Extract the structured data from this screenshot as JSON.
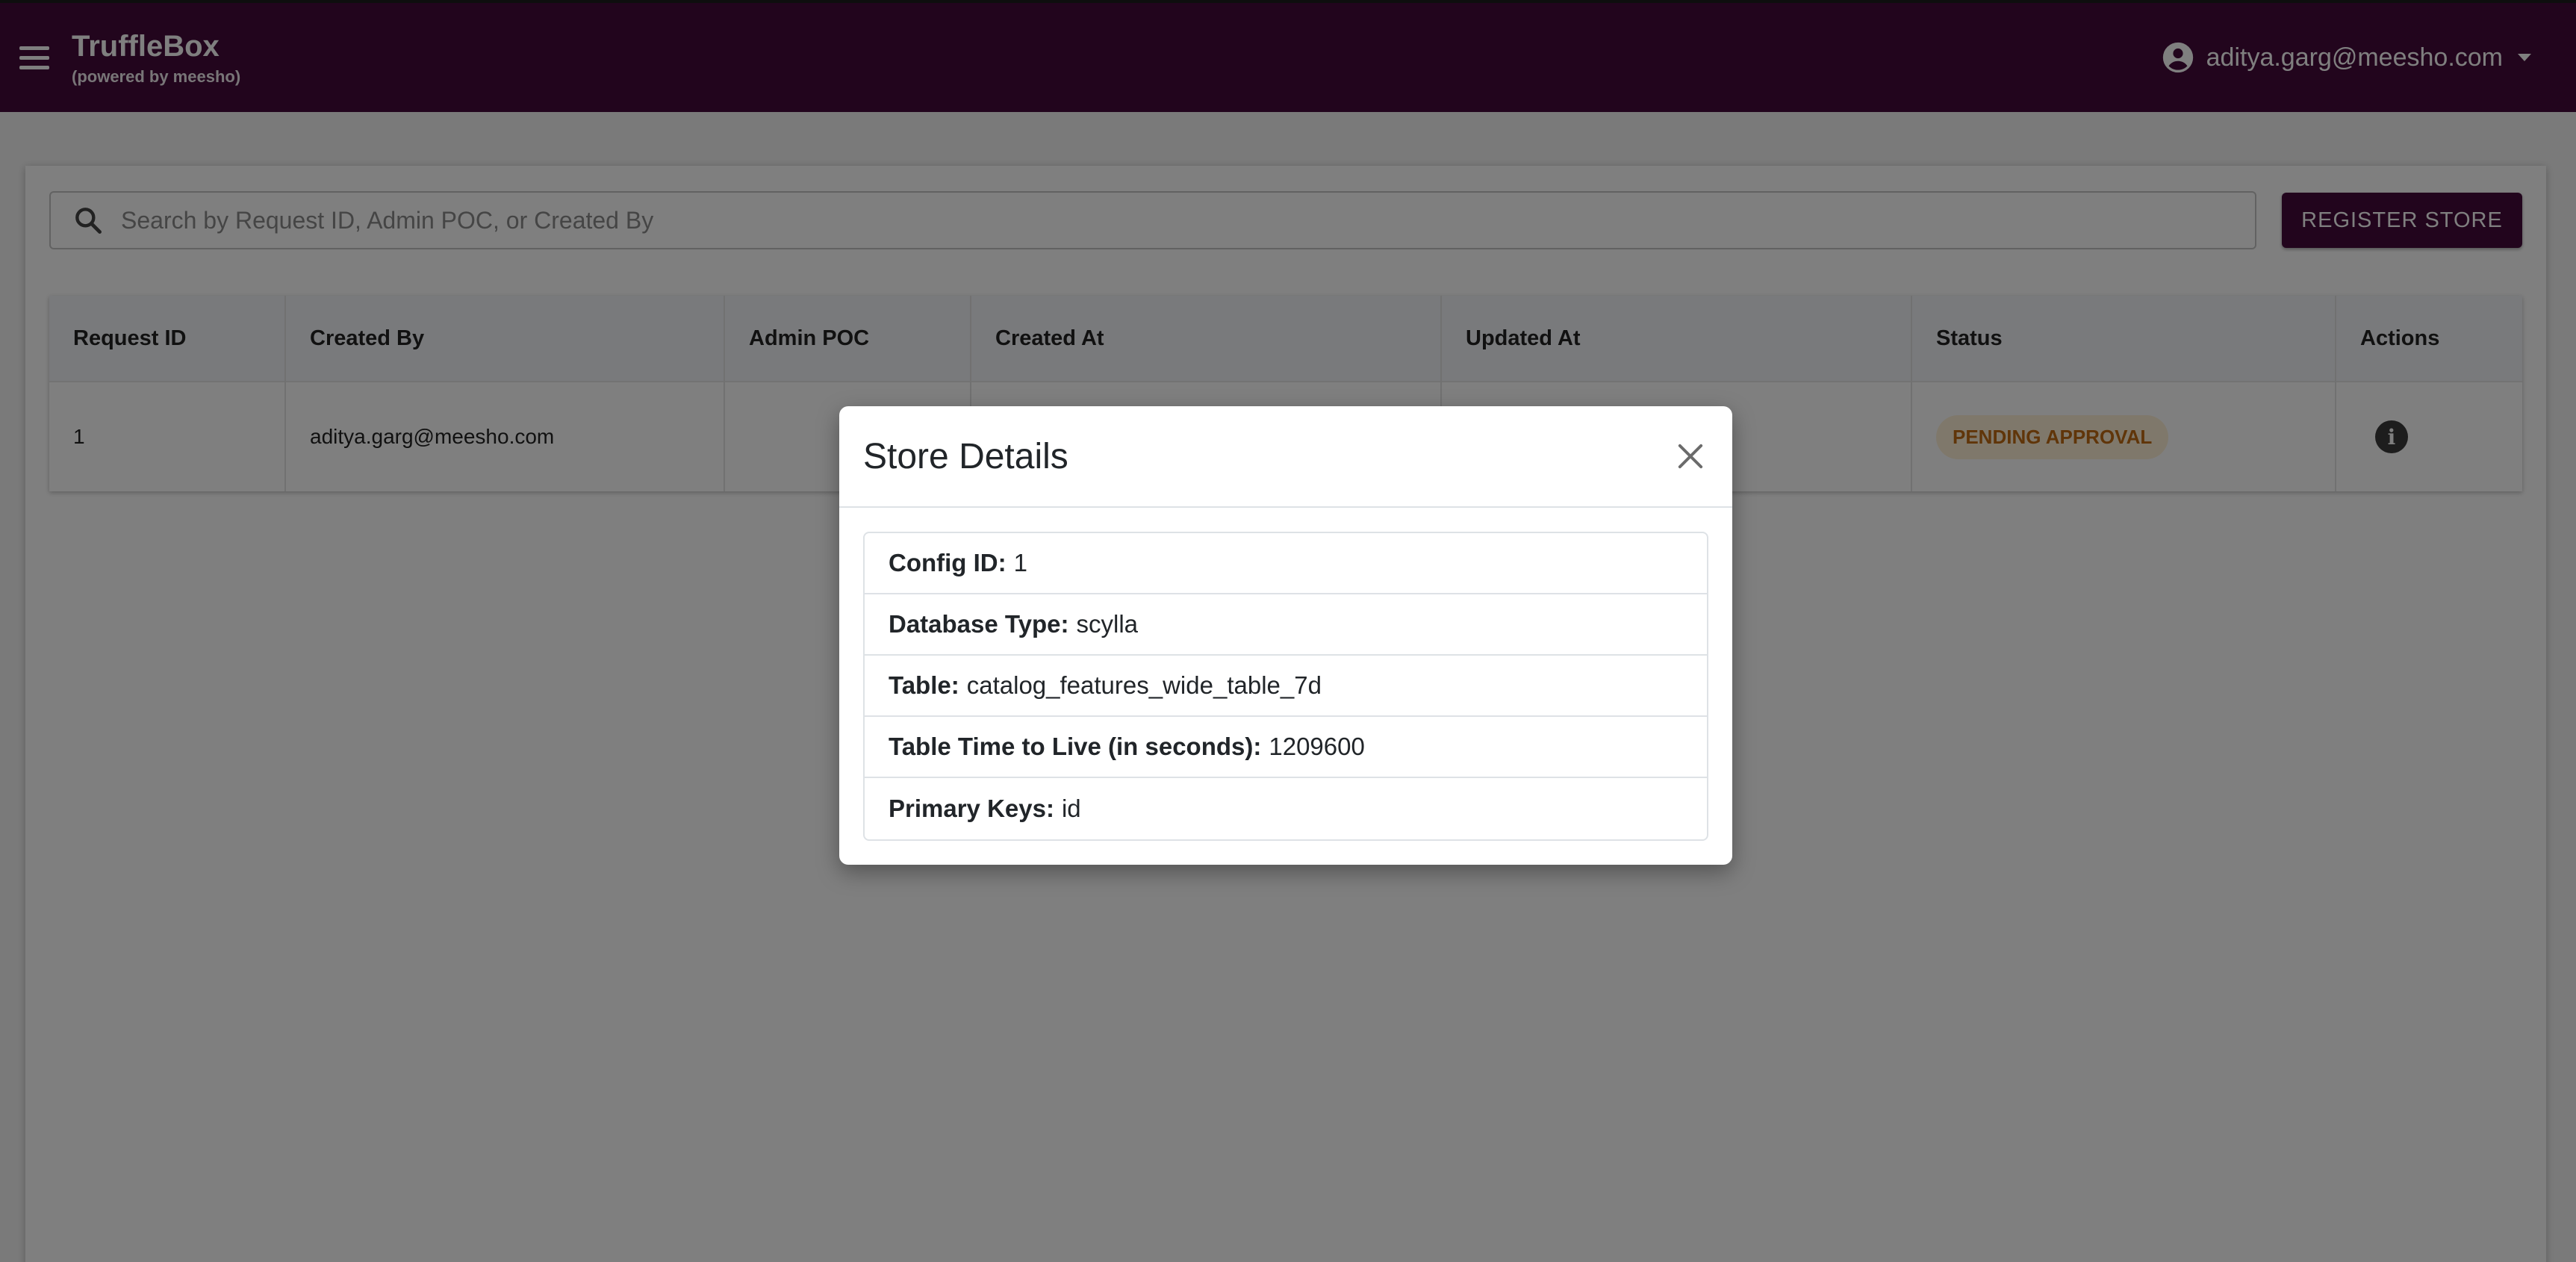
{
  "app": {
    "title": "TruffleBox",
    "subtitle": "(powered by meesho)",
    "user_email": "aditya.garg@meesho.com"
  },
  "colors": {
    "appbar": "#450a3b",
    "status_pending_text": "#c06a12",
    "status_pending_bg": "#fff1d6"
  },
  "search": {
    "placeholder": "Search by Request ID, Admin POC, or Created By",
    "value": ""
  },
  "toolbar": {
    "register_label": "REGISTER STORE"
  },
  "table": {
    "headers": [
      "Request ID",
      "Created By",
      "Admin POC",
      "Created At",
      "Updated At",
      "Status",
      "Actions"
    ],
    "rows": [
      {
        "request_id": "1",
        "created_by": "aditya.garg@meesho.com",
        "admin_poc": "",
        "created_at": "",
        "updated_at": "",
        "status": "PENDING APPROVAL",
        "action_icon": "info-icon"
      }
    ]
  },
  "modal": {
    "title": "Store Details",
    "fields": [
      {
        "label": "Config ID:",
        "value": "1"
      },
      {
        "label": "Database Type:",
        "value": "scylla"
      },
      {
        "label": "Table:",
        "value": "catalog_features_wide_table_7d"
      },
      {
        "label": "Table Time to Live (in seconds):",
        "value": "1209600"
      },
      {
        "label": "Primary Keys:",
        "value": "id"
      }
    ]
  }
}
